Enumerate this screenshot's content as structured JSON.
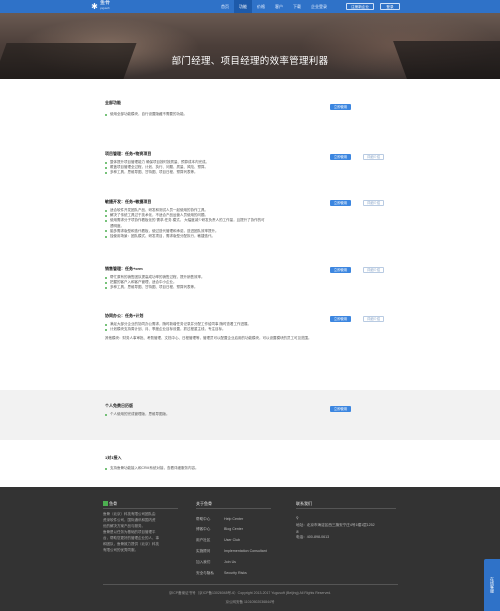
{
  "header": {
    "logo_text": "鱼骨",
    "logo_sub": "yugusoft",
    "nav": [
      "首页",
      "功能",
      "价格",
      "客户",
      "下载",
      "企业登录"
    ],
    "active_nav": "功能",
    "register_label": "注册新企业",
    "login_label": "登录"
  },
  "hero": {
    "title": "部门经理、项目经理的效率管理利器"
  },
  "sections": {
    "general": {
      "title": "全部功能",
      "items": [
        "使用全部功能模块，自行设置隐藏不需要的功能。"
      ],
      "primary": "立即使用"
    },
    "project": {
      "title": "项目管理：任务+物资项目",
      "items": [
        "整体提升项目管理能力 确保项目按时按质量、预算成本内完成。",
        "覆盖项目管理全过程，计划、执行、问题、质量、风险、预算。",
        "多种工具，思维导图、甘特图、项目日程、预算列表等。"
      ],
      "primary": "立即使用",
      "secondary": "详细介绍"
    },
    "dev": {
      "title": "敏捷开发：任务+敏捷项目",
      "items": [
        "适合软件开发团队产品、研发和测试人员一起使用的协作工具。",
        "解决了传统工具过于技术化，不适合产品运营人员使用的问题。",
        "使用需求分子项协作看板化的 需求-任务 模式。 大幅度减少研发负责人的工作量，且提升了协作的可",
        "透明度。",
        "脑多需求版型和迭代看板，使过迭代管理和承诺，迭进团队效率提升。",
        "独使用场景：团队模式、研发项目，需求版型分配执行，敏捷迭代。"
      ],
      "primary": "立即使用",
      "secondary": "详细介绍"
    },
    "sales": {
      "title": "销售管理：任务+crm",
      "items": [
        "帮忙原有的销售团队提高成功率的销售过程，提升销售效率。",
        "把握的客户入和客户管理，适合中小企业。",
        "多种工具，思维导图、甘特图、项目日程、预算列表等。"
      ],
      "primary": "立即使用",
      "secondary": "详细介绍"
    },
    "okr": {
      "title": "协同办公：任务+计划",
      "items": [
        "满足大部分企业的协同办公需求，随时新增任务记录并分配工作给同事 随时查看工作进展。",
        "计划模块支持周计划、月、季度企业目标设置，抓过程重主线，专注目标。"
      ],
      "primary": "立即使用",
      "secondary": "详细介绍"
    },
    "other": "其他模块：财务人事审批、考勤管理、文档中心、日程管理等，管理员可以配置企业启用的功能模块，可以设置模块的员工可见范围。",
    "personal": {
      "title": "个人免费日历版",
      "items": [
        "个人使用的完成管理版，思维导图版。"
      ],
      "primary": "立即使用"
    },
    "intro": {
      "title": "1对1接入",
      "items": [
        "支持鱼骨功能接入和CRM系统对接，查看详细服务内容。"
      ]
    }
  },
  "footer": {
    "brand_title": "鱼骨",
    "about": [
      "鱼骨（北京）科技有限公司团队由",
      "资深软件公司，国际通讯和国内资",
      "优的解决方案产品与服务。",
      "鱼骨是以任务为基础的项目管理平",
      "台，帮助您更好的管理企业的人、事",
      "和团队，鱼骨致力提供（北京）科技",
      "有限公司的优秀同服。"
    ],
    "links_title": "关于鱼骨",
    "links": [
      [
        "帮助中心",
        "Help Center"
      ],
      [
        "博客中心",
        "Blog Center"
      ],
      [
        "用户社区",
        "User Club"
      ],
      [
        "实施顾问",
        "Implementation Consultant"
      ],
      [
        "加入我们",
        "Join Us"
      ],
      [
        "安全与隐私",
        "Security Risks"
      ]
    ],
    "contact_title": "联系我们",
    "address": "地址：北京市海淀区西三旗安宁庄4号1幢1层1252",
    "phone": "电话：400-898-0613",
    "copyright": "京ICP备案证书号（京ICP备13026048号-6）Copyright 2013-2017 Yugusoft (Beijing) All Rights Reserved.",
    "icp": "京公网安备 11010502036844号",
    "side_tab": "在线客服"
  },
  "colors": {
    "brand": "#2f72c8",
    "accent_button": "#3c86e0",
    "footer_bg": "#333333",
    "bullet": "#4caf50"
  }
}
